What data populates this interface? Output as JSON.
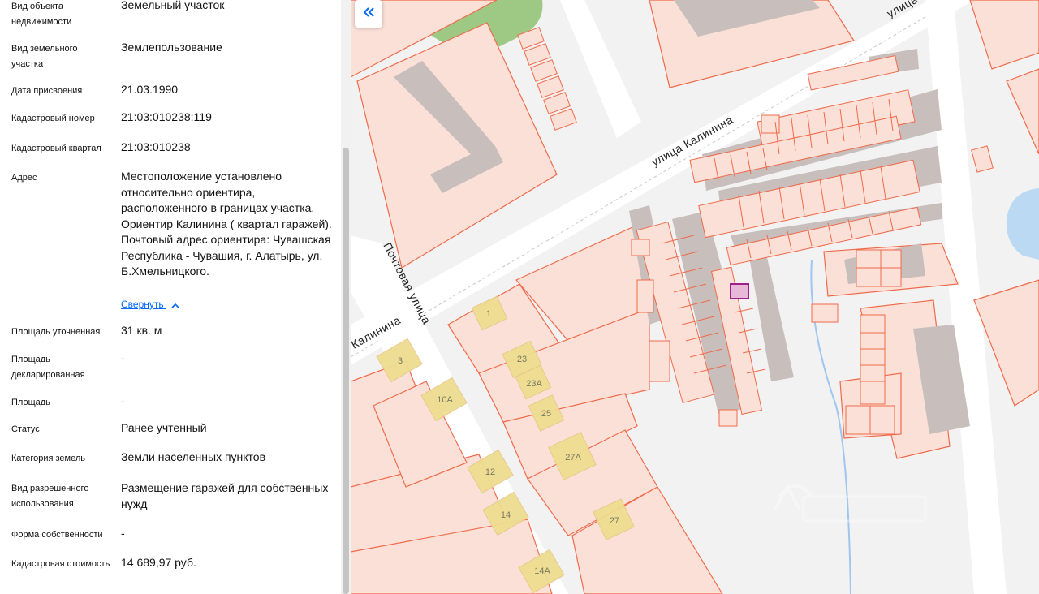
{
  "details": [
    {
      "label": "Вид объекта недвижимости",
      "value": "Земельный участок"
    },
    {
      "label": "Вид земельного участка",
      "value": "Землепользование"
    },
    {
      "label": "Дата присвоения",
      "value": "21.03.1990"
    },
    {
      "label": "Кадастровый номер",
      "value": "21:03:010238:119"
    },
    {
      "label": "Кадастровый квартал",
      "value": "21:03:010238"
    },
    {
      "label": "Адрес",
      "value": "Местоположение установлено относительно ориентира, расположенного в границах участка. Ориентир Калинина ( квартал гаражей). Почтовый адрес ориентира: Чувашская Республика - Чувашия, г. Алатырь, ул. Б.Хмельницкого."
    },
    {
      "label": "Площадь уточненная",
      "value": "31 кв. м"
    },
    {
      "label": "Площадь декларированная",
      "value": "-"
    },
    {
      "label": "Площадь",
      "value": "-"
    },
    {
      "label": "Статус",
      "value": "Ранее учтенный"
    },
    {
      "label": "Категория земель",
      "value": "Земли населенных пунктов"
    },
    {
      "label": "Вид разрешенного использования",
      "value": "Размещение гаражей для собственных нужд"
    },
    {
      "label": "Форма собственности",
      "value": "-"
    },
    {
      "label": "Кадастровая стоимость",
      "value": "14 689,97 руб."
    }
  ],
  "address_collapse_label": "Свернуть",
  "map": {
    "streets": {
      "kalinina_main": "улица Калинина",
      "kalinina_left": "Калинина",
      "kalinina_top": "улица",
      "pochtovaya": "Почтовая улица"
    },
    "house_numbers": [
      "1",
      "23",
      "23А",
      "25",
      "27А",
      "27",
      "3",
      "10А",
      "12",
      "14",
      "14А"
    ],
    "colors": {
      "parcel_stroke": "#f06a4a",
      "parcel_fill": "#fbe0d8",
      "building": "#c8bebc",
      "house_fill": "#eedd90",
      "selected": "#a0208a",
      "green": "#9ec985",
      "water": "#bcd9f3"
    },
    "icons": {
      "collapse_button": "double-chevron-left-icon",
      "watermark": "cian-logo"
    }
  },
  "colors": {
    "link": "#0468ff",
    "text": "#121212"
  }
}
